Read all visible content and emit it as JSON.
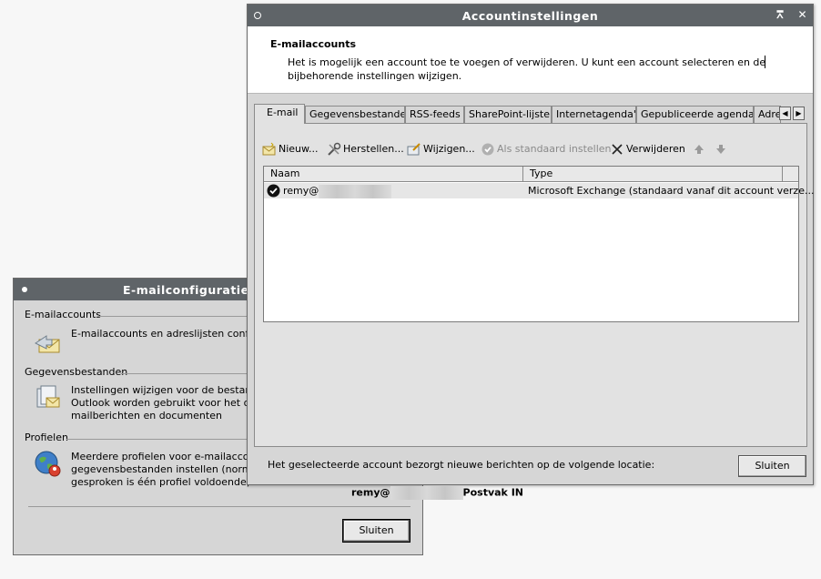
{
  "email_config": {
    "title": "E-mailconfiguratie",
    "sections": [
      {
        "heading": "E-mailaccounts",
        "text": "E-mailaccounts en adreslijsten configure",
        "icon": "email-accounts-icon"
      },
      {
        "heading": "Gegevensbestanden",
        "text": "Instellingen wijzigen voor de bestanden\nOutlook worden gebruikt voor het opsla\nmailberichten en documenten",
        "icon": "data-files-icon"
      },
      {
        "heading": "Profielen",
        "text": "Meerdere profielen voor e-mailaccounts\ngegevensbestanden instellen (normaal\ngesproken is één profiel voldoende)",
        "icon": "profiles-icon"
      }
    ],
    "close_button": "Sluiten"
  },
  "account_settings": {
    "title": "Accountinstellingen",
    "header_title": "E-mailaccounts",
    "header_desc": "Het is mogelijk een account toe te voegen of verwijderen. U kunt een account selecteren en de bijbehorende instellingen wijzigen.",
    "tabs": [
      "E-mail",
      "Gegevensbestanden",
      "RSS-feeds",
      "SharePoint-lijsten",
      "Internetagenda's",
      "Gepubliceerde agenda's",
      "Adre"
    ],
    "active_tab": "E-mail",
    "toolbar": {
      "new": "Nieuw...",
      "repair": "Herstellen...",
      "change": "Wijzigen...",
      "set_default": "Als standaard instellen",
      "remove": "Verwijderen"
    },
    "columns": [
      "Naam",
      "Type"
    ],
    "rows": [
      {
        "name": "remy@",
        "type": "Microsoft Exchange (standaard vanaf dit account verze..."
      }
    ],
    "info_label": "Het geselecteerde account bezorgt nieuwe berichten op de volgende locatie:",
    "location_prefix": "remy@",
    "location_suffix": "Postvak IN",
    "close_button": "Sluiten"
  }
}
